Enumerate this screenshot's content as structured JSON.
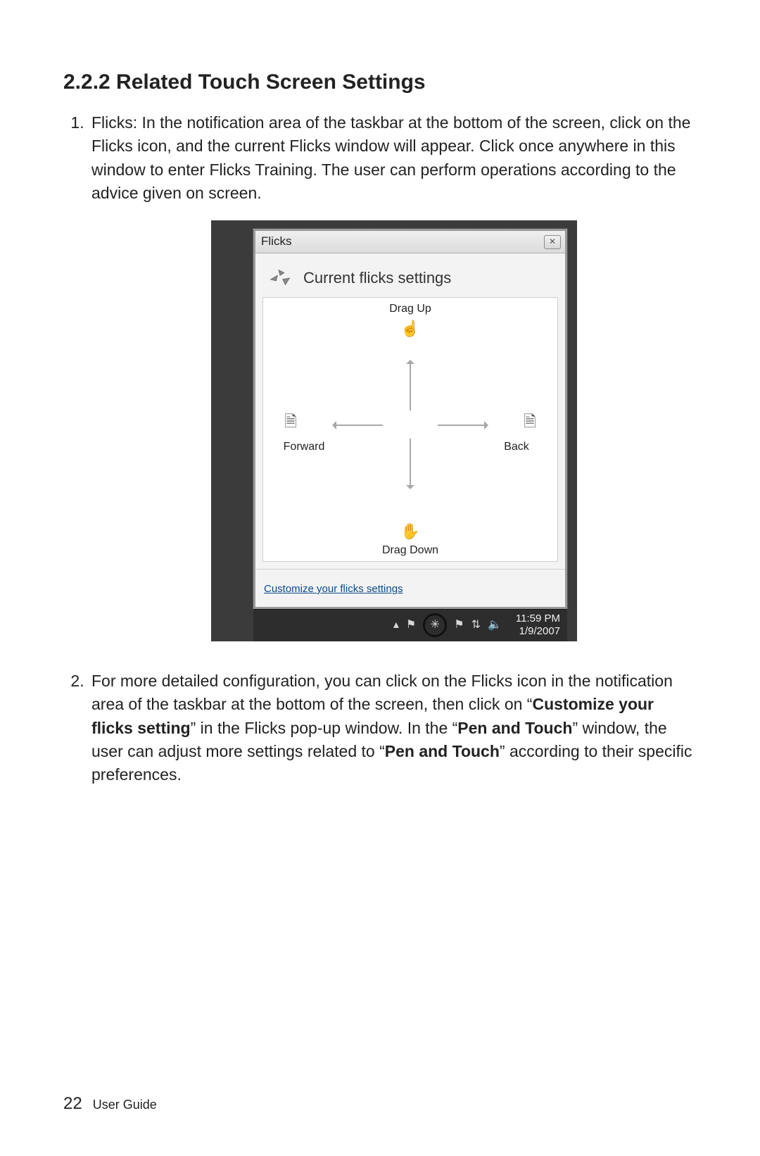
{
  "heading": "2.2.2 Related Touch Screen Settings",
  "items": {
    "one": "Flicks: In the notification area of the taskbar at the bottom of the screen, click on the Flicks icon, and the current Flicks window will appear. Click once anywhere in this window to enter Flicks Training. The user can perform operations according to the advice given on screen.",
    "two_a": "For more detailed configuration, you can click on the Flicks icon in the notification area of the taskbar at the bottom of the screen, then click on “",
    "two_b_bold": "Customize your flicks setting",
    "two_c": "” in the Flicks pop-up window. In the “",
    "two_d_bold": "Pen and Touch",
    "two_e": "” window, the user can adjust more settings related to “",
    "two_f_bold": "Pen and Touch",
    "two_g": "” according to their specific preferences."
  },
  "flicks": {
    "title": "Flicks",
    "header": "Current flicks settings",
    "drag_up": "Drag Up",
    "drag_down": "Drag Down",
    "forward": "Forward",
    "back": "Back",
    "customize_link": "Customize your flicks settings"
  },
  "taskbar": {
    "time": "11:59 PM",
    "date": "1/9/2007"
  },
  "footer": {
    "page_number": "22",
    "doc_title": "User Guide"
  }
}
